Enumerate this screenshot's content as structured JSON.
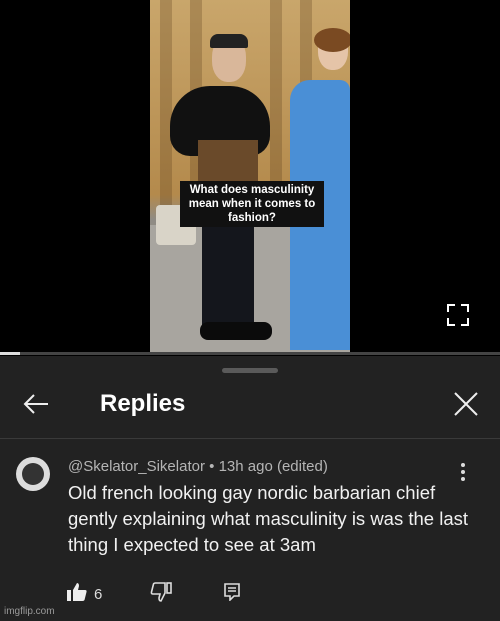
{
  "video": {
    "caption": "What does masculinity mean when it comes to fashion?",
    "fullscreen_icon": "fullscreen-icon",
    "progress": 0.04
  },
  "replies_sheet": {
    "title": "Replies",
    "back_icon": "arrow-left-icon",
    "close_icon": "close-icon"
  },
  "comment": {
    "author": "@Skelator_Sikelator",
    "separator": " • ",
    "time": "13h ago (edited)",
    "text": "Old french looking gay nordic barbarian chief gently explaining what masculinity is was the last thing I expected to see at 3am",
    "like_count": "6",
    "icons": {
      "like": "thumbs-up-icon",
      "dislike": "thumbs-down-icon",
      "reply": "reply-icon",
      "more": "more-vert-icon"
    }
  },
  "watermark": "imgflip.com"
}
